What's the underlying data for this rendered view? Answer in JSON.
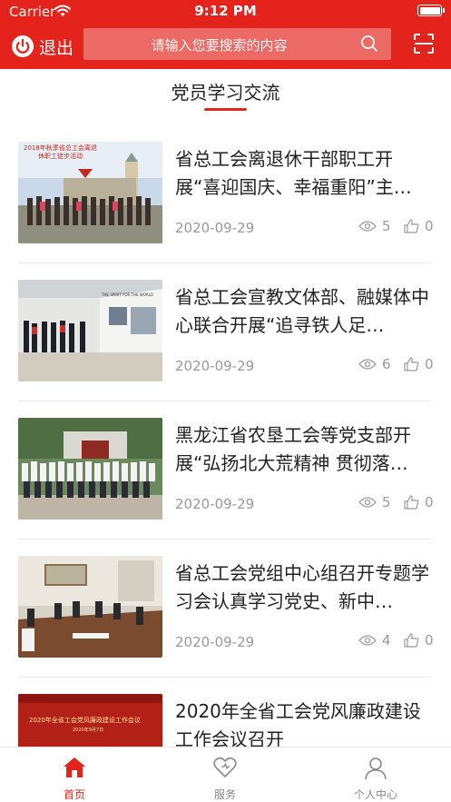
{
  "status_bar": {
    "carrier": "Carrier",
    "time": "9:12 PM"
  },
  "header": {
    "logout_label": "退出",
    "search_placeholder": "请输入您要搜索的内容"
  },
  "section": {
    "title": "党员学习交流"
  },
  "articles": [
    {
      "title": "省总工会离退休干部职工开展“喜迎国庆、幸福重阳”主…",
      "date": "2020-09-29",
      "views": "5",
      "likes": "0",
      "image_caption_line1": "2018年秋季省总工会离退",
      "image_caption_line2": "休职工徒步活动"
    },
    {
      "title": "省总工会宣教文体部、融媒体中心联合开展“追寻铁人足…",
      "date": "2020-09-29",
      "views": "6",
      "likes": "0",
      "image_caption_line1": "THE SPIRIT FOR THE WORLD"
    },
    {
      "title": "黑龙江省农垦工会等党支部开展“弘扬北大荒精神 贯彻落…",
      "date": "2020-09-29",
      "views": "5",
      "likes": "0"
    },
    {
      "title": "省总工会党组中心组召开专题学习会认真学习党史、新中…",
      "date": "2020-09-29",
      "views": "4",
      "likes": "0"
    },
    {
      "title": "2020年全省工会党风廉政建设工作会议召开",
      "date": "",
      "views": "",
      "likes": "",
      "image_caption_line1": "2020年全省工会党风廉政建设工作会议",
      "image_caption_line2": "2020年9月7日"
    }
  ],
  "tabbar": {
    "home": "首页",
    "service": "服务",
    "profile": "个人中心"
  },
  "colors": {
    "accent": "#e4241c",
    "muted": "#999999"
  }
}
